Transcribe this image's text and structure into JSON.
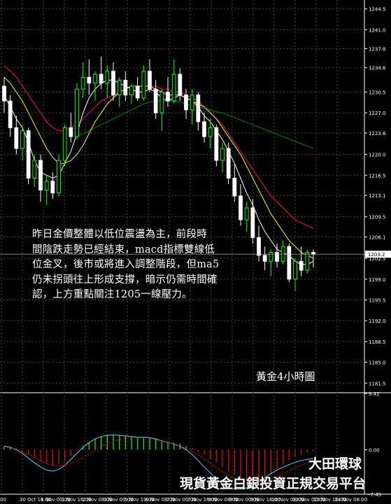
{
  "annotation": {
    "lines": [
      "昨日金價整體以低位震盪為主，前段時",
      "間陰跌走勢已經結束，macd指標雙線低",
      "位金叉，後市或將進入調整階段，但ma5",
      "仍未拐頭往上形成支撐，暗示仍需時間確",
      "認，上方重點關注1205一線壓力。"
    ],
    "chart_label": "黃金4小時圖"
  },
  "brand": {
    "line1": "大田環球",
    "line2": "現貨黃金白銀投資正規交易平台"
  },
  "chart_data": [
    {
      "type": "candlestick",
      "ylim": [
        1180.0,
        1246.0
      ],
      "y_ticks": [
        "1244.5",
        "1241.0",
        "1237.8",
        "1234.6",
        "1230.5",
        "1227.0",
        "1223.6",
        "1220.0",
        "1216.5",
        "1213.1",
        "1209.5",
        "1206.1",
        "1202.5",
        "1199.0",
        "1195.5",
        "1192.0",
        "1188.5",
        "1185.0",
        "1181.5"
      ],
      "current_price": "1203.2",
      "colors": {
        "up": "#00ff00",
        "down": "#ffffff",
        "ma_fast": "#ffffff",
        "ma_mid": "#ffff00",
        "ma_slow": "#ff0066",
        "ma_long": "#008000",
        "grid": "#3a4a3a"
      },
      "grid": true,
      "candles": [
        [
          1231.5,
          1233.0,
          1227.0,
          1229.0
        ],
        [
          1229.0,
          1230.0,
          1223.0,
          1224.5
        ],
        [
          1224.5,
          1226.5,
          1220.0,
          1221.0
        ],
        [
          1221.0,
          1225.0,
          1219.0,
          1224.0
        ],
        [
          1224.0,
          1224.5,
          1215.0,
          1216.0
        ],
        [
          1216.0,
          1220.0,
          1214.5,
          1219.0
        ],
        [
          1219.0,
          1220.0,
          1212.0,
          1214.0
        ],
        [
          1214.0,
          1216.5,
          1211.5,
          1215.5
        ],
        [
          1215.5,
          1217.0,
          1212.5,
          1213.5
        ],
        [
          1213.5,
          1220.0,
          1213.0,
          1219.0
        ],
        [
          1219.0,
          1225.0,
          1218.0,
          1224.5
        ],
        [
          1224.5,
          1227.0,
          1222.0,
          1223.0
        ],
        [
          1223.0,
          1232.0,
          1222.5,
          1231.0
        ],
        [
          1231.0,
          1235.5,
          1229.5,
          1233.0
        ],
        [
          1233.0,
          1236.0,
          1230.0,
          1232.0
        ],
        [
          1232.0,
          1234.0,
          1229.0,
          1233.5
        ],
        [
          1233.5,
          1236.5,
          1231.0,
          1232.0
        ],
        [
          1232.0,
          1235.0,
          1229.5,
          1234.0
        ],
        [
          1234.0,
          1235.5,
          1229.0,
          1230.0
        ],
        [
          1230.0,
          1233.0,
          1228.0,
          1232.5
        ],
        [
          1232.5,
          1234.0,
          1229.0,
          1230.0
        ],
        [
          1230.0,
          1232.0,
          1228.5,
          1231.5
        ],
        [
          1231.5,
          1233.0,
          1229.0,
          1229.5
        ],
        [
          1229.5,
          1235.0,
          1229.0,
          1234.0
        ],
        [
          1234.0,
          1236.0,
          1230.5,
          1231.0
        ],
        [
          1231.0,
          1232.5,
          1226.0,
          1227.0
        ],
        [
          1227.0,
          1231.0,
          1224.0,
          1230.5
        ],
        [
          1230.5,
          1233.0,
          1228.0,
          1229.0
        ],
        [
          1229.0,
          1236.0,
          1228.5,
          1233.5
        ],
        [
          1233.5,
          1234.5,
          1229.0,
          1230.0
        ],
        [
          1230.0,
          1231.0,
          1226.0,
          1227.5
        ],
        [
          1227.5,
          1231.0,
          1225.0,
          1230.0
        ],
        [
          1230.0,
          1230.5,
          1224.0,
          1225.5
        ],
        [
          1225.5,
          1227.0,
          1222.0,
          1223.0
        ],
        [
          1223.0,
          1226.0,
          1221.0,
          1224.5
        ],
        [
          1224.5,
          1225.0,
          1218.0,
          1219.0
        ],
        [
          1219.0,
          1222.0,
          1217.0,
          1221.0
        ],
        [
          1221.0,
          1222.0,
          1215.0,
          1216.0
        ],
        [
          1216.0,
          1218.5,
          1212.0,
          1213.0
        ],
        [
          1213.0,
          1215.0,
          1208.0,
          1209.0
        ],
        [
          1209.0,
          1212.0,
          1207.0,
          1211.0
        ],
        [
          1211.0,
          1212.5,
          1205.0,
          1206.0
        ],
        [
          1206.0,
          1208.0,
          1202.0,
          1203.0
        ],
        [
          1203.0,
          1204.5,
          1200.5,
          1202.0
        ],
        [
          1202.0,
          1204.0,
          1199.5,
          1203.5
        ],
        [
          1203.5,
          1205.0,
          1201.0,
          1202.0
        ],
        [
          1202.0,
          1205.5,
          1201.5,
          1204.5
        ],
        [
          1204.5,
          1205.0,
          1198.5,
          1199.0
        ],
        [
          1199.0,
          1202.5,
          1197.0,
          1202.0
        ],
        [
          1202.0,
          1204.5,
          1199.5,
          1200.5
        ],
        [
          1200.5,
          1204.0,
          1200.0,
          1203.5
        ],
        [
          1203.5,
          1204.0,
          1201.0,
          1203.2
        ]
      ],
      "ma_fast": [
        1230.0,
        1228.0,
        1226.0,
        1224.5,
        1222.0,
        1219.0,
        1217.0,
        1216.5,
        1216.0,
        1216.5,
        1218.5,
        1220.5,
        1223.5,
        1227.0,
        1229.5,
        1231.0,
        1232.0,
        1232.5,
        1232.5,
        1232.0,
        1231.5,
        1231.0,
        1230.5,
        1230.5,
        1231.0,
        1230.5,
        1229.5,
        1229.0,
        1229.5,
        1230.0,
        1229.5,
        1229.0,
        1228.0,
        1226.5,
        1225.5,
        1224.0,
        1222.5,
        1220.5,
        1218.5,
        1216.0,
        1213.5,
        1211.5,
        1209.0,
        1207.0,
        1205.5,
        1204.0,
        1203.5,
        1203.0,
        1202.0,
        1201.5,
        1201.5,
        1202.0
      ],
      "ma_mid": [
        1233.0,
        1232.0,
        1230.5,
        1229.0,
        1227.0,
        1225.0,
        1223.0,
        1221.0,
        1219.5,
        1218.5,
        1218.5,
        1219.0,
        1220.0,
        1221.5,
        1223.5,
        1225.5,
        1227.0,
        1228.5,
        1229.5,
        1230.5,
        1231.0,
        1231.5,
        1231.5,
        1231.5,
        1231.5,
        1231.0,
        1230.5,
        1230.0,
        1230.0,
        1230.0,
        1229.5,
        1229.0,
        1228.5,
        1228.0,
        1227.0,
        1226.0,
        1224.5,
        1223.0,
        1221.5,
        1220.0,
        1218.0,
        1216.0,
        1214.0,
        1212.0,
        1210.0,
        1208.5,
        1207.0,
        1205.5,
        1204.5,
        1203.5,
        1203.0,
        1202.5
      ],
      "ma_slow": [
        1235.0,
        1234.0,
        1233.0,
        1231.5,
        1230.0,
        1228.5,
        1227.0,
        1225.5,
        1224.5,
        1224.0,
        1224.0,
        1224.5,
        1225.0,
        1226.0,
        1227.0,
        1228.0,
        1229.0,
        1229.5,
        1230.0,
        1230.5,
        1231.0,
        1231.5,
        1231.5,
        1231.5,
        1231.5,
        1231.5,
        1231.0,
        1231.0,
        1230.5,
        1230.5,
        1230.0,
        1229.5,
        1229.0,
        1228.0,
        1227.0,
        1226.0,
        1225.0,
        1223.5,
        1222.0,
        1220.5,
        1219.0,
        1217.5,
        1216.0,
        1214.5,
        1213.0,
        1212.0,
        1211.0,
        1210.0,
        1209.0,
        1208.5,
        1208.0,
        1207.5
      ],
      "ma_long": [
        null,
        null,
        null,
        null,
        null,
        null,
        null,
        null,
        null,
        null,
        null,
        null,
        1223.0,
        1223.5,
        1224.0,
        1224.5,
        1225.0,
        1225.5,
        1226.0,
        1226.5,
        1227.0,
        1227.5,
        1228.0,
        1228.5,
        1228.8,
        1229.0,
        1229.0,
        1229.0,
        1229.0,
        1228.8,
        1228.5,
        1228.2,
        1228.0,
        1227.8,
        1227.5,
        1227.2,
        1227.0,
        1226.6,
        1226.2,
        1225.8,
        1225.4,
        1225.0,
        1224.6,
        1224.2,
        1223.8,
        1223.4,
        1223.0,
        1222.6,
        1222.2,
        1221.8,
        1221.4,
        1221.0
      ]
    },
    {
      "type": "macd",
      "ylim": [
        -7.45,
        9.42
      ],
      "y_ticks": [
        "9.42",
        "0.00",
        "-7.45"
      ],
      "colors": {
        "hist_pos": "#00ff00",
        "hist_neg": "#ff0000",
        "signal": "#ff0000",
        "macd": "#66ccff"
      },
      "histogram": [
        0.6,
        0.4,
        0.2,
        -0.3,
        -0.8,
        -1.4,
        -2.0,
        -2.4,
        -2.6,
        -2.4,
        -1.8,
        -1.0,
        -0.2,
        0.6,
        1.2,
        1.8,
        2.2,
        2.4,
        2.5,
        2.4,
        2.3,
        2.2,
        2.1,
        2.1,
        2.0,
        1.8,
        1.5,
        1.3,
        1.2,
        1.0,
        0.6,
        0.2,
        -0.3,
        -0.9,
        -1.5,
        -2.2,
        -2.9,
        -3.6,
        -4.2,
        -4.7,
        -5.0,
        -5.2,
        -5.0,
        -4.6,
        -4.0,
        -3.3,
        -2.5,
        -1.8,
        -1.2,
        -0.8,
        -0.5,
        -0.3
      ],
      "signal": [
        0.4,
        0.3,
        0.1,
        -0.3,
        -0.8,
        -1.3,
        -1.8,
        -2.3,
        -2.6,
        -2.7,
        -2.6,
        -2.3,
        -1.9,
        -1.3,
        -0.7,
        -0.1,
        0.5,
        1.0,
        1.4,
        1.7,
        1.9,
        2.0,
        2.0,
        2.0,
        1.9,
        1.7,
        1.5,
        1.2,
        0.9,
        0.6,
        0.2,
        -0.3,
        -0.9,
        -1.6,
        -2.3,
        -3.0,
        -3.7,
        -4.3,
        -4.8,
        -5.2,
        -5.4,
        -5.5,
        -5.4,
        -5.2,
        -4.9,
        -4.5,
        -4.0,
        -3.5,
        -3.0,
        -2.6,
        -2.2,
        -1.9
      ],
      "macd": [
        0.6,
        0.4,
        0.0,
        -0.6,
        -1.4,
        -2.2,
        -2.9,
        -3.4,
        -3.6,
        -3.3,
        -2.6,
        -1.6,
        -0.6,
        0.4,
        1.2,
        1.8,
        2.2,
        2.4,
        2.5,
        2.4,
        2.3,
        2.2,
        2.1,
        2.1,
        2.0,
        1.8,
        1.5,
        1.2,
        0.9,
        0.6,
        0.0,
        -0.8,
        -1.8,
        -2.9,
        -3.9,
        -4.9,
        -5.7,
        -6.3,
        -6.6,
        -6.6,
        -6.4,
        -6.0,
        -5.4,
        -4.7,
        -4.0,
        -3.4,
        -2.9,
        -2.5,
        -2.1,
        -1.8,
        -1.6,
        -1.5
      ]
    }
  ],
  "x_ticks": [
    "00",
    "30 Oct 16:00",
    "1 Nov 00:00",
    "1 Nov 16:00",
    "2 Nov 08:00",
    "3 Nov 00:00",
    "5 Nov 19:00",
    "6 Nov 08:00",
    "7 Nov 00:00",
    "7 Nov 16:00",
    "8 Nov 08:00",
    "9 Nov 00:00",
    "9 Nov 16:00",
    "10 Nov 08:00",
    "13 Nov 00:00",
    "13 Nov 16:00",
    "14 Nov 08:00"
  ]
}
